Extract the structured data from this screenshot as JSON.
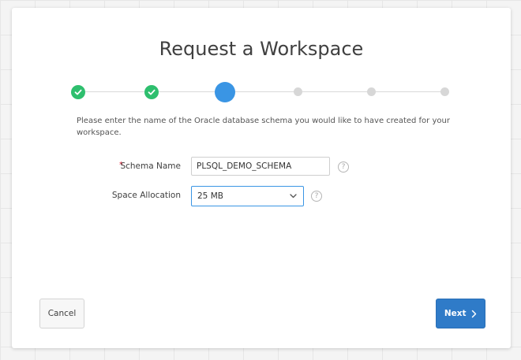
{
  "dialog": {
    "title": "Request a Workspace",
    "instruction": "Please enter the name of the Oracle database schema you would like to have created for your workspace."
  },
  "progress": {
    "total_steps": 6,
    "current_step": 3,
    "steps": [
      {
        "state": "complete",
        "icon": "check-icon"
      },
      {
        "state": "complete",
        "icon": "check-icon"
      },
      {
        "state": "current"
      },
      {
        "state": "pending"
      },
      {
        "state": "pending"
      },
      {
        "state": "pending"
      }
    ]
  },
  "form": {
    "schema_name": {
      "label": "Schema Name",
      "required_marker": "*",
      "value": "PLSQL_DEMO_SCHEMA",
      "help_icon": "help-icon",
      "help_glyph": "?"
    },
    "space_allocation": {
      "label": "Space Allocation",
      "selected": "25 MB",
      "help_icon": "help-icon",
      "help_glyph": "?"
    }
  },
  "buttons": {
    "cancel_label": "Cancel",
    "next_label": "Next"
  },
  "colors": {
    "complete": "#2ebf6e",
    "current": "#3a95e4",
    "pending": "#d7d7d7",
    "primary_button": "#2f7bc8",
    "required": "#e0001a"
  }
}
